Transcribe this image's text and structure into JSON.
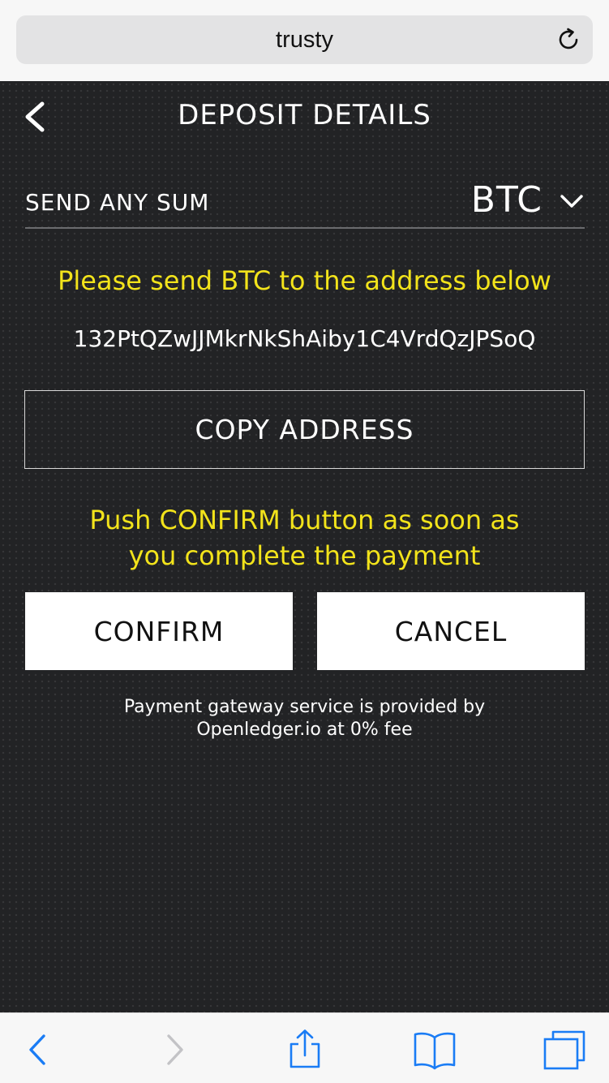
{
  "browser": {
    "url_label": "trusty"
  },
  "header": {
    "title": "DEPOSIT DETAILS"
  },
  "deposit": {
    "sum_label": "SEND ANY SUM",
    "coin": "BTC",
    "instruction": "Please send BTC to the address below",
    "address": "132PtQZwJJMkrNkShAiby1C4VrdQzJPSoQ",
    "copy_label": "COPY ADDRESS",
    "confirm_hint_line1": "Push CONFIRM button as soon as",
    "confirm_hint_line2": "you complete the payment",
    "confirm_label": "CONFIRM",
    "cancel_label": "CANCEL",
    "footer_line1": "Payment gateway service is provided by",
    "footer_line2": "Openledger.io at 0% fee"
  },
  "colors": {
    "background": "#222325",
    "accent_yellow": "#f2e31b",
    "safari_blue": "#1a7cf5"
  },
  "icons": {
    "back": "chevron-left-icon",
    "dropdown": "chevron-down-icon",
    "reload": "reload-icon",
    "browser_back": "browser-back-icon",
    "browser_forward": "browser-forward-icon",
    "share": "share-icon",
    "bookmarks": "bookmarks-icon",
    "tabs": "tabs-icon"
  }
}
